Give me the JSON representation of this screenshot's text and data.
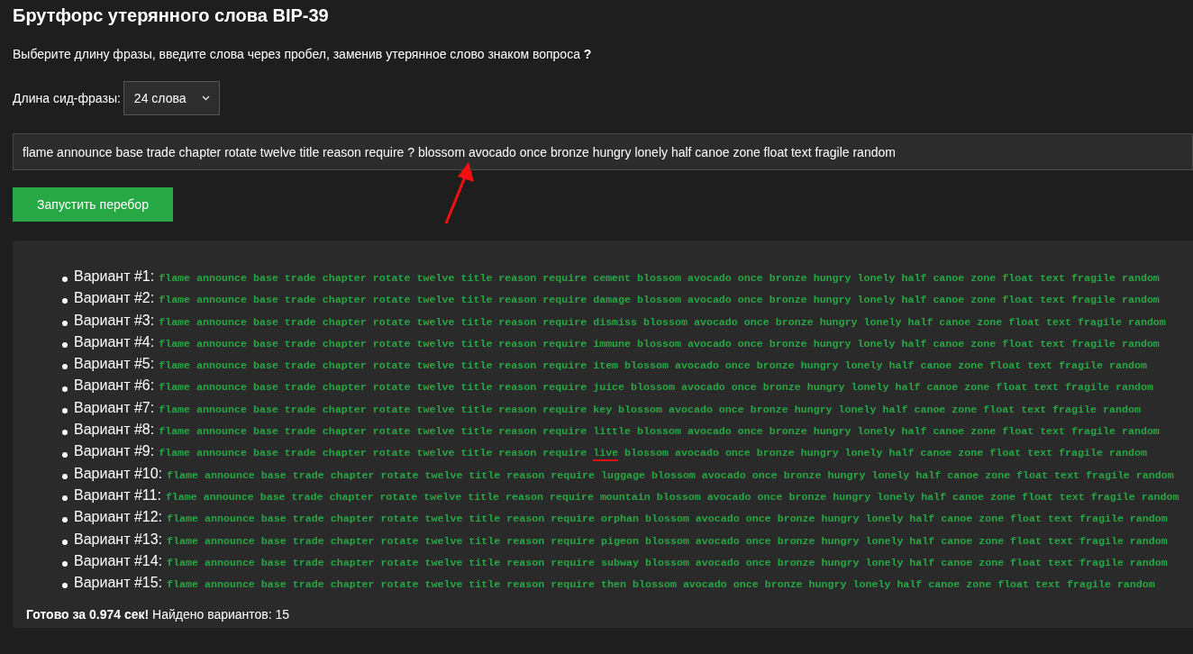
{
  "title": "Брутфорс утерянного слова BIP-39",
  "instruction": "Выберите длину фразы, введите слова через пробел, заменив утерянное слово знаком вопроса **?**",
  "length_select": {
    "label": "Длина сид-фразы:",
    "value": "24 слова"
  },
  "phrase_input": {
    "value": "flame announce base trade chapter rotate twelve title reason require ? blossom avocado once bronze hungry lonely half canoe zone float text fragile random"
  },
  "run_button": "Запустить перебор",
  "variants": [
    {
      "label": "Вариант #1:",
      "phrase": "flame announce base trade chapter rotate twelve title reason require cement blossom avocado once bronze hungry lonely half canoe zone float text fragile random",
      "underlined": false
    },
    {
      "label": "Вариант #2:",
      "phrase": "flame announce base trade chapter rotate twelve title reason require damage blossom avocado once bronze hungry lonely half canoe zone float text fragile random",
      "underlined": false
    },
    {
      "label": "Вариант #3:",
      "phrase": "flame announce base trade chapter rotate twelve title reason require dismiss blossom avocado once bronze hungry lonely half canoe zone float text fragile random",
      "underlined": false
    },
    {
      "label": "Вариант #4:",
      "phrase": "flame announce base trade chapter rotate twelve title reason require immune blossom avocado once bronze hungry lonely half canoe zone float text fragile random",
      "underlined": false
    },
    {
      "label": "Вариант #5:",
      "phrase": "flame announce base trade chapter rotate twelve title reason require item blossom avocado once bronze hungry lonely half canoe zone float text fragile random",
      "underlined": false
    },
    {
      "label": "Вариант #6:",
      "phrase": "flame announce base trade chapter rotate twelve title reason require juice blossom avocado once bronze hungry lonely half canoe zone float text fragile random",
      "underlined": false
    },
    {
      "label": "Вариант #7:",
      "phrase": "flame announce base trade chapter rotate twelve title reason require key blossom avocado once bronze hungry lonely half canoe zone float text fragile random",
      "underlined": false
    },
    {
      "label": "Вариант #8:",
      "phrase": "flame announce base trade chapter rotate twelve title reason require little blossom avocado once bronze hungry lonely half canoe zone float text fragile random",
      "underlined": false
    },
    {
      "label": "Вариант #9:",
      "phrase": "flame announce base trade chapter rotate twelve title reason require live blossom avocado once bronze hungry lonely half canoe zone float text fragile random",
      "underlined": true
    },
    {
      "label": "Вариант #10:",
      "phrase": "flame announce base trade chapter rotate twelve title reason require luggage blossom avocado once bronze hungry lonely half canoe zone float text fragile random",
      "underlined": false
    },
    {
      "label": "Вариант #11:",
      "phrase": "flame announce base trade chapter rotate twelve title reason require mountain blossom avocado once bronze hungry lonely half canoe zone float text fragile random",
      "underlined": false
    },
    {
      "label": "Вариант #12:",
      "phrase": "flame announce base trade chapter rotate twelve title reason require orphan blossom avocado once bronze hungry lonely half canoe zone float text fragile random",
      "underlined": false
    },
    {
      "label": "Вариант #13:",
      "phrase": "flame announce base trade chapter rotate twelve title reason require pigeon blossom avocado once bronze hungry lonely half canoe zone float text fragile random",
      "underlined": false
    },
    {
      "label": "Вариант #14:",
      "phrase": "flame announce base trade chapter rotate twelve title reason require subway blossom avocado once bronze hungry lonely half canoe zone float text fragile random",
      "underlined": false
    },
    {
      "label": "Вариант #15:",
      "phrase": "flame announce base trade chapter rotate twelve title reason require then blossom avocado once bronze hungry lonely half canoe zone float text fragile random",
      "underlined": false
    }
  ],
  "status": "**Готово за 0.974 сек!** Найдено вариантов: 15"
}
